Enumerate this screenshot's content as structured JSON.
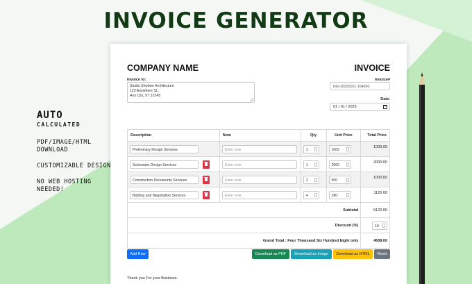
{
  "banner": {
    "title": "INVOICE GENERATOR",
    "features": {
      "auto_title": "AUTO",
      "auto_sub": "CALCULATED",
      "items": [
        "PDF/IMAGE/HTML DOWNLOAD",
        "CUSTOMIZABLE DESIGN",
        "NO WEB HOSTING NEEDED!"
      ]
    }
  },
  "invoice": {
    "company_name": "COMPANY NAME",
    "heading": "INVOICE",
    "invoice_to_label": "Invoice to:",
    "invoice_to_lines": [
      "Studio Shodwe Architecture",
      "123 Anywhere St.,",
      "Any City, ST 12345"
    ],
    "invoice_no_label": "Invoice#",
    "invoice_no_value": "INV-20250101-164656",
    "date_label": "Date:",
    "date_value": "01 / 01 / 2025",
    "table": {
      "headers": [
        "Description",
        "Note",
        "Qty",
        "Unit Price",
        "Total Price"
      ],
      "note_placeholder": "Enter note",
      "rows": [
        {
          "description": "Preliminary Design Services",
          "qty": "1",
          "unit_price": "1000",
          "total": "1000.00"
        },
        {
          "description": "Schematic Design Services",
          "qty": "1",
          "unit_price": "2000",
          "total": "2000.00"
        },
        {
          "description": "Construction Documents Services",
          "qty": "2",
          "unit_price": "500",
          "total": "1000.00"
        },
        {
          "description": "Bidding and Negotiation Services",
          "qty": "4",
          "unit_price": "280",
          "total": "1120.00"
        }
      ],
      "subtotal_label": "Subtotal",
      "subtotal_value": "5120.00",
      "discount_label": "Discount (%)",
      "discount_value": "10",
      "grand_total_label": "Grand Total : Four Thousand Six Hundred Eight only",
      "grand_total_value": "4608.00"
    },
    "buttons": {
      "add_row": "Add Row",
      "pdf": "Download as PDF",
      "image": "Download as Image",
      "html": "Download as HTML",
      "reset": "Reset"
    },
    "footer_note": "Thank you For your Business."
  },
  "colors": {
    "add_row": "#0d6efd",
    "pdf": "#198754",
    "image": "#17a2b8",
    "html": "#ffc107",
    "reset": "#6c757d",
    "delete": "#dc3545",
    "background_green": "#bde9bd"
  }
}
